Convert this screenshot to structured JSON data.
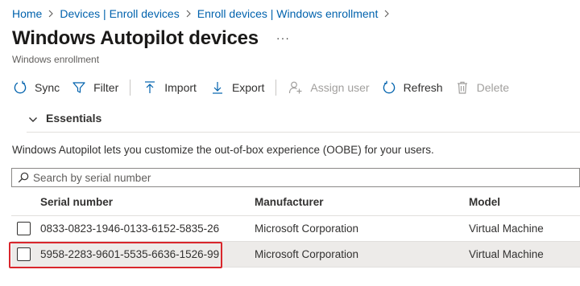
{
  "breadcrumb": [
    {
      "label": "Home"
    },
    {
      "label": "Devices | Enroll devices"
    },
    {
      "label": "Enroll devices | Windows enrollment"
    }
  ],
  "page": {
    "title": "Windows Autopilot devices",
    "more": "···",
    "subtitle": "Windows enrollment"
  },
  "toolbar": {
    "sync": "Sync",
    "filter": "Filter",
    "import": "Import",
    "export": "Export",
    "assign_user": "Assign user",
    "refresh": "Refresh",
    "delete": "Delete"
  },
  "essentials": {
    "label": "Essentials"
  },
  "info_text": "Windows Autopilot lets you customize the out-of-box experience (OOBE) for your users.",
  "search": {
    "placeholder": "Search by serial number"
  },
  "table": {
    "columns": {
      "serial": "Serial number",
      "manufacturer": "Manufacturer",
      "model": "Model"
    },
    "rows": [
      {
        "serial": "0833-0823-1946-0133-6152-5835-26",
        "manufacturer": "Microsoft Corporation",
        "model": "Virtual Machine"
      },
      {
        "serial": "5958-2283-9601-5535-6636-1526-99",
        "manufacturer": "Microsoft Corporation",
        "model": "Virtual Machine"
      }
    ]
  },
  "colors": {
    "link": "#0062ad",
    "highlight": "#d9262c",
    "selected_row": "#edebe9"
  }
}
